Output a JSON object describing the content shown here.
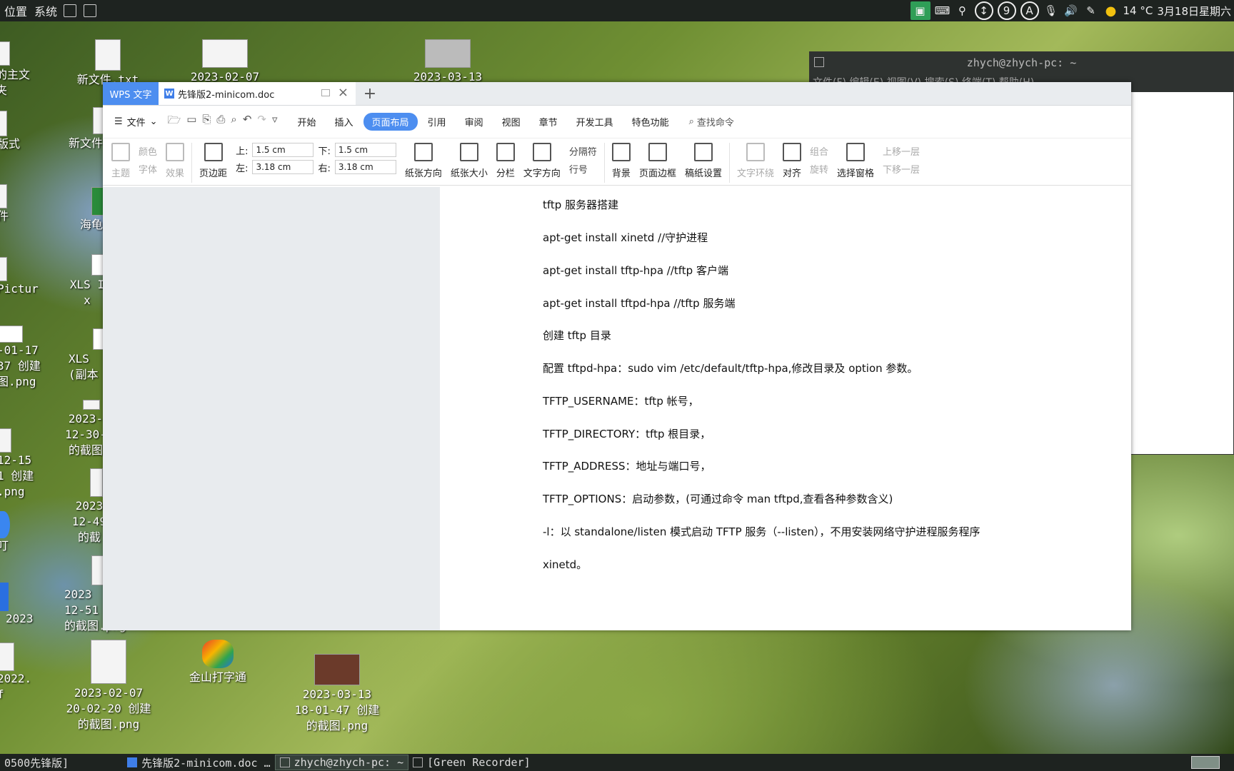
{
  "top_panel": {
    "menus": [
      "位置",
      "系统"
    ],
    "tray": {
      "temperature": "14 °C",
      "date": "3月18日星期六",
      "badge_9": "9",
      "badge_a": "A"
    }
  },
  "desktop_icons": [
    {
      "label": "的主文\n夹"
    },
    {
      "label": "新文件.txt"
    },
    {
      "label": "2023-02-07"
    },
    {
      "label": "2023-03-13"
    },
    {
      "label": "版式"
    },
    {
      "label": "新文件"
    },
    {
      "label": "件"
    },
    {
      "label": "海龟"
    },
    {
      "label": "Pictur"
    },
    {
      "label": "XLS I\nx"
    },
    {
      "label": "-01-17\n37 创建\n图.png"
    },
    {
      "label": "XLS\n(副本"
    },
    {
      "label": "2023-\n12-30-\n的截图"
    },
    {
      "label": "12-15\n1 创建\n.png"
    },
    {
      "label": "2023\n12-49\n的截"
    },
    {
      "label": "叮"
    },
    {
      "label": "2023\n12-51\n的截图.png"
    },
    {
      "label": "2023"
    },
    {
      "label": "2022.\nf"
    },
    {
      "label": "2023-02-07\n20-02-20 创建\n的截图.png"
    },
    {
      "label": "金山打字通"
    },
    {
      "label": "2023-03-13\n18-01-47 创建\n的截图.png"
    }
  ],
  "terminal": {
    "title": "zhych@zhych-pc: ~",
    "menu": "文件(F) 编辑(E) 视图(V) 搜索(S) 终端(T) 帮助(H)"
  },
  "wps": {
    "app_tab": "WPS 文字",
    "doc_tab": "先锋版2-minicom.doc",
    "file_menu": "文件",
    "menu_tabs": [
      "开始",
      "插入",
      "页面布局",
      "引用",
      "审阅",
      "视图",
      "章节",
      "开发工具",
      "特色功能"
    ],
    "active_tab": "页面布局",
    "search_label": "查找命令",
    "ribbon": {
      "theme": "主题",
      "color": "颜色",
      "font": "字体",
      "effect": "效果",
      "margin": "页边距",
      "margin_top_label": "上:",
      "margin_top": "1.5 cm",
      "margin_bottom_label": "下:",
      "margin_bottom": "1.5 cm",
      "margin_left_label": "左:",
      "margin_left": "3.18 cm",
      "margin_right_label": "右:",
      "margin_right": "3.18 cm",
      "orientation": "纸张方向",
      "size": "纸张大小",
      "columns": "分栏",
      "text_dir": "文字方向",
      "separator": "分隔符",
      "line_no": "行号",
      "background": "背景",
      "border": "页面边框",
      "paper_setup": "稿纸设置",
      "wrap": "文字环绕",
      "align": "对齐",
      "group": "组合",
      "rotate": "旋转",
      "select_pane": "选择窗格",
      "bring_fwd": "上移一层",
      "send_back": "下移一层"
    },
    "document_lines": [
      "tftp  服务器搭建",
      "apt-get install xinetd    //守护进程",
      "apt-get install tftp-hpa    //tftp 客户端",
      "apt-get install tftpd-hpa //tftp 服务端",
      "创建 tftp 目录",
      "配置 tftpd-hpa：sudo vim /etc/default/tftp-hpa,修改目录及 option 参数。",
      "TFTP_USERNAME：tftp 帐号，",
      "TFTP_DIRECTORY：tftp 根目录，",
      "TFTP_ADDRESS：地址与端口号，",
      "TFTP_OPTIONS：启动参数，(可通过命令  man tftpd,查看各种参数含义)",
      "-l：以 standalone/listen 模式启动 TFTP 服务（--listen），不用安装网络守护进程服务程序",
      "xinetd。"
    ]
  },
  "taskbar": {
    "items": [
      "0500先锋版]",
      "先锋版2-minicom.doc …",
      "zhych@zhych-pc: ~",
      "[Green Recorder]"
    ]
  }
}
